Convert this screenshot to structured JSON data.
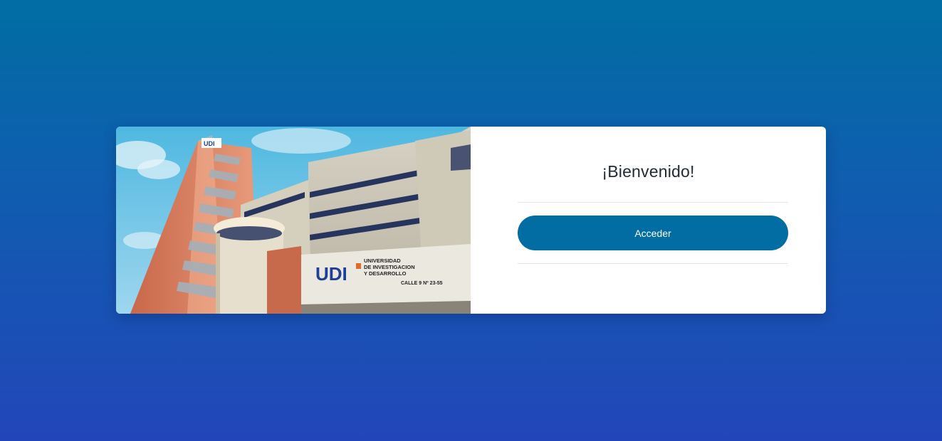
{
  "login_card": {
    "image": {
      "alt": "Edificio Universidad de Investigación y Desarrollo",
      "sign_logo": "UDI",
      "sign_line1": "UNIVERSIDAD",
      "sign_line2": "DE INVESTIGACION",
      "sign_line3": "Y DESARROLLO",
      "sign_address": "CALLE 9 Nº 23-55",
      "tower_logo": "UDI"
    },
    "welcome_title": "¡Bienvenido!",
    "access_button_label": "Acceder"
  },
  "colors": {
    "background_top": "#016da3",
    "background_bottom": "#2246b9",
    "button": "#016da3",
    "card": "#ffffff"
  }
}
